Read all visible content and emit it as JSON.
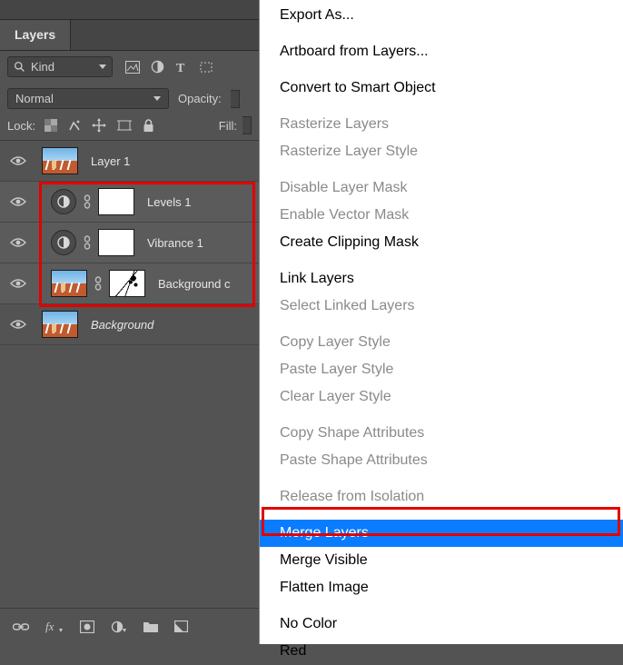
{
  "panel": {
    "tab": "Layers",
    "filter": {
      "kind_label": "Kind"
    },
    "blend_mode": "Normal",
    "opacity_label": "Opacity:",
    "lock_label": "Lock:",
    "fill_label": "Fill:"
  },
  "layers": [
    {
      "name": "Layer 1",
      "type": "image",
      "selected": false,
      "italic": false
    },
    {
      "name": "Levels 1",
      "type": "adjustment",
      "selected": true,
      "italic": false
    },
    {
      "name": "Vibrance 1",
      "type": "adjustment",
      "selected": true,
      "italic": false
    },
    {
      "name": "Background copy",
      "type": "image-masked",
      "selected": true,
      "italic": false,
      "truncated": "Background c"
    },
    {
      "name": "Background",
      "type": "image",
      "selected": false,
      "italic": true
    }
  ],
  "menu": {
    "groups": [
      [
        {
          "label": "Export As...",
          "enabled": true
        }
      ],
      [
        {
          "label": "Artboard from Layers...",
          "enabled": true
        }
      ],
      [
        {
          "label": "Convert to Smart Object",
          "enabled": true
        }
      ],
      [
        {
          "label": "Rasterize Layers",
          "enabled": false
        },
        {
          "label": "Rasterize Layer Style",
          "enabled": false
        }
      ],
      [
        {
          "label": "Disable Layer Mask",
          "enabled": false
        },
        {
          "label": "Enable Vector Mask",
          "enabled": false
        },
        {
          "label": "Create Clipping Mask",
          "enabled": true
        }
      ],
      [
        {
          "label": "Link Layers",
          "enabled": true
        },
        {
          "label": "Select Linked Layers",
          "enabled": false
        }
      ],
      [
        {
          "label": "Copy Layer Style",
          "enabled": false
        },
        {
          "label": "Paste Layer Style",
          "enabled": false
        },
        {
          "label": "Clear Layer Style",
          "enabled": false
        }
      ],
      [
        {
          "label": "Copy Shape Attributes",
          "enabled": false
        },
        {
          "label": "Paste Shape Attributes",
          "enabled": false
        }
      ],
      [
        {
          "label": "Release from Isolation",
          "enabled": false
        }
      ],
      [
        {
          "label": "Merge Layers",
          "enabled": true,
          "highlight": true
        },
        {
          "label": "Merge Visible",
          "enabled": true
        },
        {
          "label": "Flatten Image",
          "enabled": true
        }
      ],
      [
        {
          "label": "No Color",
          "enabled": true
        },
        {
          "label": "Red",
          "enabled": true
        }
      ]
    ]
  }
}
